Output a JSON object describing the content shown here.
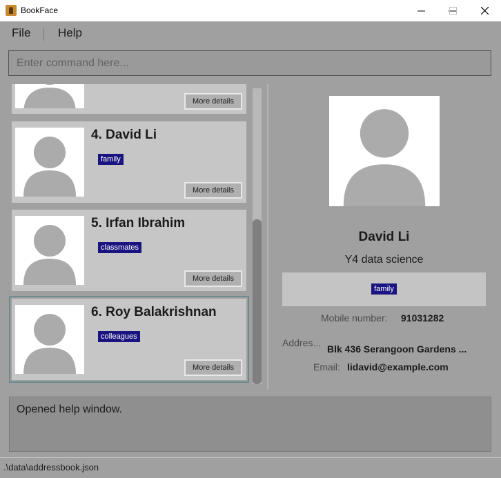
{
  "window": {
    "title": "BookFace"
  },
  "menu": {
    "file": "File",
    "help": "Help"
  },
  "command": {
    "placeholder": "Enter command here..."
  },
  "list": {
    "cards": [
      {
        "name": "",
        "tag": "",
        "button": "More details"
      },
      {
        "name": "4. David Li",
        "tag": "family",
        "button": "More details"
      },
      {
        "name": "5. Irfan Ibrahim",
        "tag": "classmates",
        "button": "More details"
      },
      {
        "name": "6. Roy Balakrishnan",
        "tag": "colleagues",
        "button": "More details"
      }
    ]
  },
  "detail": {
    "name": "David Li",
    "subtitle": "Y4 data science",
    "tag": "family",
    "mobile_label": "Mobile number:",
    "mobile_value": "91031282",
    "address_label": "Addres...",
    "address_value": "Blk 436 Serangoon Gardens ...",
    "email_label": "Email:",
    "email_value": "lidavid@example.com"
  },
  "result": {
    "text": "Opened help window."
  },
  "status": {
    "path": ".\\data\\addressbook.json"
  },
  "colors": {
    "tag": "#1a1480",
    "background": "#a0a0a0",
    "card": "#c6c6c6"
  }
}
